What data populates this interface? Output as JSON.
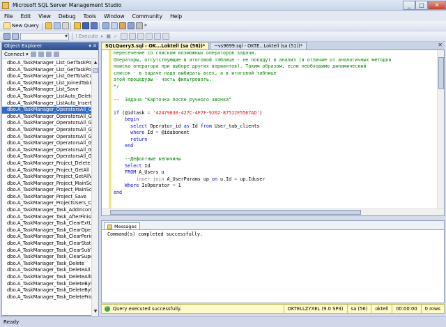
{
  "window": {
    "title": "Microsoft SQL Server Management Studio",
    "minimize": "_",
    "maximize": "□",
    "close": "✕"
  },
  "menu": [
    "File",
    "Edit",
    "View",
    "Debug",
    "Tools",
    "Window",
    "Community",
    "Help"
  ],
  "toolbar": {
    "new_query": "New Query",
    "execute": "Execute"
  },
  "object_explorer": {
    "title": "Object Explorer",
    "header_buttons": "▾ ✕",
    "connect": "Connect ▾",
    "items": [
      "dbo.A_TaskManager_List_GetTaskPointIn",
      "dbo.A_TaskManager_List_GetTaskPointIn",
      "dbo.A_TaskManager_List_GetTotalCount",
      "dbo.A_TaskManager_List_JoinedTable_Ge",
      "dbo.A_TaskManager_List_Save",
      "dbo.A_TaskManager_ListAuto_DeleteRow",
      "dbo.A_TaskManager_ListAuto_InsertRow",
      "dbo.A_TaskManager_OperatorsAll_Get_C",
      "dbo.A_TaskManager_OperatorsAll_Get_C",
      "dbo.A_TaskManager_OperatorsAll_Get_D",
      "dbo.A_TaskManager_OperatorsAll_Get_D",
      "dbo.A_TaskManager_OperatorsAll_Get_Fr",
      "dbo.A_TaskManager_OperatorsAll_Get_Fr",
      "dbo.A_TaskManager_OperatorsAll_Get_T",
      "dbo.A_TaskManager_OperatorsAll_Get_T",
      "dbo.A_TaskManager_Project_Delete",
      "dbo.A_TaskManager_Project_GetAll",
      "dbo.A_TaskManager_Project_GetAllViewe",
      "dbo.A_TaskManager_Project_MainScriptC",
      "dbo.A_TaskManager_Project_MainScriptC",
      "dbo.A_TaskManager_Project_Save",
      "dbo.A_TaskManager_ProjectUsers_Clear",
      "dbo.A_TaskManager_Task_AddIncoming",
      "dbo.A_TaskManager_Task_AfterFinished",
      "dbo.A_TaskManager_Task_ClearExtLines",
      "dbo.A_TaskManager_Task_ClearOperator",
      "dbo.A_TaskManager_Task_ClearPeriods",
      "dbo.A_TaskManager_Task_ClearStatistics",
      "dbo.A_TaskManager_Task_ClearSubTasks",
      "dbo.A_TaskManager_Task_ClearSupervise",
      "dbo.A_TaskManager_Task_Delete",
      "dbo.A_TaskManager_Task_DeleteAll",
      "dbo.A_TaskManager_Task_DeleteAllDone",
      "dbo.A_TaskManager_Task_DeleteById",
      "dbo.A_TaskManager_Task_DeleteByName",
      "dbo.A_TaskManager_Task_DeleteFromScri"
    ],
    "selected_index": 7
  },
  "tabs": [
    "SQLQuery3.sql - OK...Loktell (sa (56))*",
    "~vs9699.sql - OKTE...Loktell (sa (51))*"
  ],
  "tab_close": "✕",
  "editor_lines": [
    [
      [
        "comment",
        "пересечение со списком возможных операторов задачи."
      ]
    ],
    [
      [
        "comment",
        "Операторы, отсутствующие в итоговой таблице - не попадут в анализ (в отличие от аналогичных методов"
      ]
    ],
    [
      [
        "comment",
        "поиска оператора при выборе других вариантов). Таким образом, если необходимо динамический"
      ]
    ],
    [
      [
        "comment",
        "список - в задаче надо выбирать всех, а в итоговой таблице"
      ]
    ],
    [
      [
        "comment",
        "этой процедуры - часть фильтровать."
      ]
    ],
    [
      [
        "comment",
        "*/"
      ]
    ],
    [
      [
        "plain",
        ""
      ]
    ],
    [
      [
        "comment",
        "--  Задача \"Карточка после ручного звонка\""
      ]
    ],
    [
      [
        "plain",
        ""
      ]
    ],
    [
      [
        "kw",
        "if"
      ],
      [
        "plain",
        " (@idtask "
      ],
      [
        "gray",
        "="
      ],
      [
        "plain",
        " "
      ],
      [
        "str",
        "'42479030-427C-4F7F-9262-87512F5567AD'"
      ],
      [
        "plain",
        ")"
      ]
    ],
    [
      [
        "plain",
        "    "
      ],
      [
        "kw",
        "begin"
      ]
    ],
    [
      [
        "plain",
        "      "
      ],
      [
        "kw",
        "select"
      ],
      [
        "plain",
        " Operator_id "
      ],
      [
        "kw",
        "as"
      ],
      [
        "plain",
        " Id "
      ],
      [
        "kw",
        "from"
      ],
      [
        "plain",
        " User_tab_clients"
      ]
    ],
    [
      [
        "plain",
        "      "
      ],
      [
        "kw",
        "where"
      ],
      [
        "plain",
        " Id "
      ],
      [
        "gray",
        "="
      ],
      [
        "plain",
        " @idabonent"
      ]
    ],
    [
      [
        "plain",
        "      "
      ],
      [
        "kw",
        "return"
      ]
    ],
    [
      [
        "plain",
        "    "
      ],
      [
        "kw",
        "end"
      ]
    ],
    [
      [
        "plain",
        ""
      ]
    ],
    [
      [
        "plain",
        "    "
      ],
      [
        "comment",
        "--Дефолтные величины"
      ]
    ],
    [
      [
        "plain",
        "    "
      ],
      [
        "kw",
        "Select"
      ],
      [
        "plain",
        " Id"
      ]
    ],
    [
      [
        "plain",
        "    "
      ],
      [
        "kw",
        "FROM"
      ],
      [
        "plain",
        " A_Users u"
      ]
    ],
    [
      [
        "plain",
        "        "
      ],
      [
        "gray",
        "inner join"
      ],
      [
        "plain",
        " A_UserParams up "
      ],
      [
        "kw",
        "on"
      ],
      [
        "plain",
        " u.Id "
      ],
      [
        "gray",
        "="
      ],
      [
        "plain",
        " up.Iduser"
      ]
    ],
    [
      [
        "plain",
        "    "
      ],
      [
        "kw",
        "Where"
      ],
      [
        "plain",
        " IsOperator "
      ],
      [
        "gray",
        "="
      ],
      [
        "plain",
        " 1"
      ]
    ],
    [
      [
        "kw",
        "end"
      ]
    ]
  ],
  "messages": {
    "tab_label": "Messages",
    "text": "Command(s) completed successfully."
  },
  "query_status": {
    "message": "Query executed successfully.",
    "server": "OKTELLZYXEL (9.0 SP3)",
    "login": "sa (56)",
    "database": "oktell",
    "time": "00:00:00",
    "rows": "0 rows"
  },
  "status_bar": "Ready"
}
